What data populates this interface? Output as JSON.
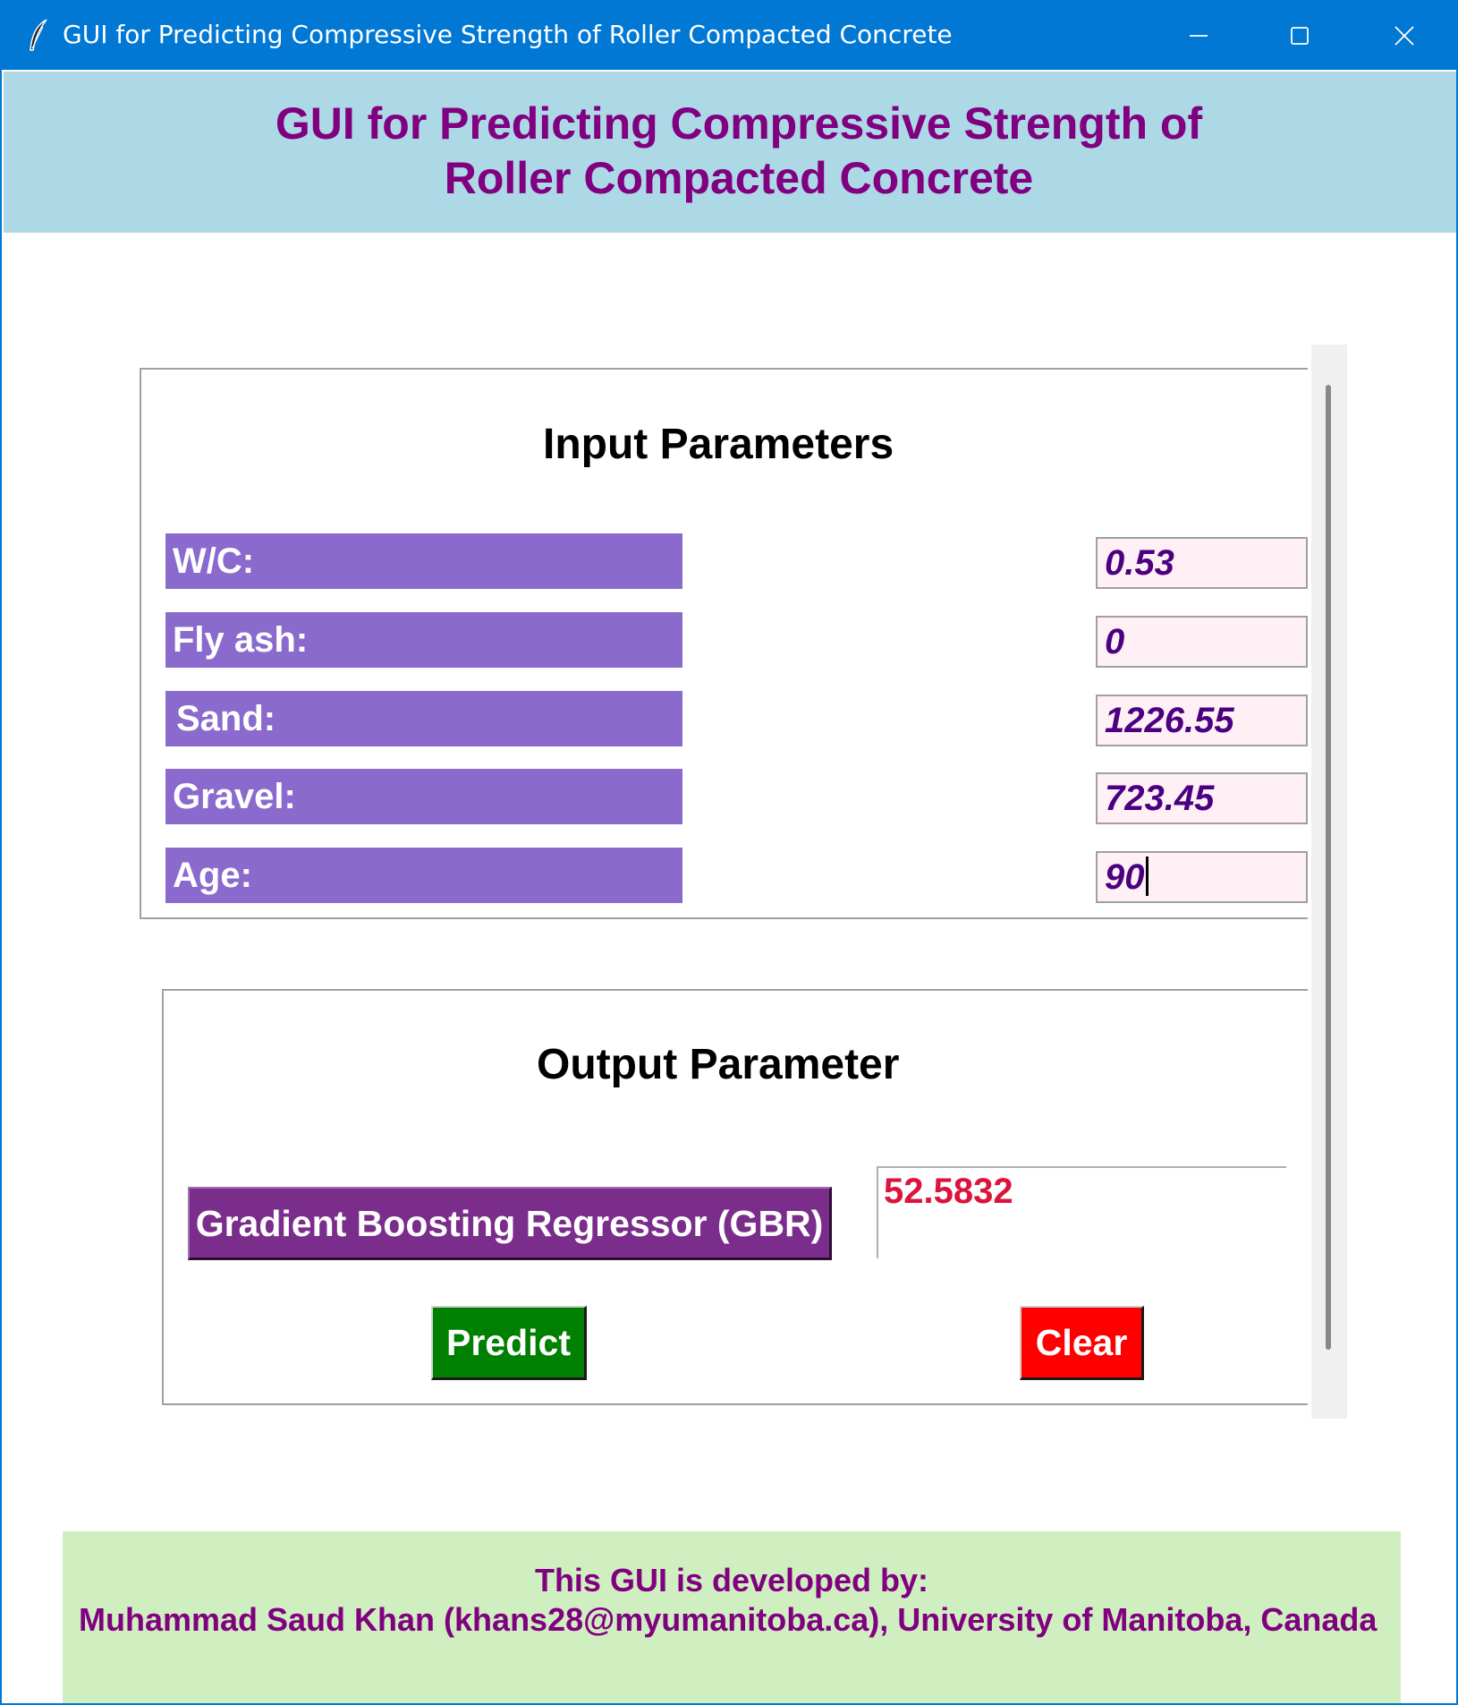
{
  "window": {
    "title": "GUI for Predicting Compressive Strength of Roller Compacted Concrete",
    "icon": "feather-icon",
    "controls": [
      "minimize-icon",
      "maximize-icon",
      "close-icon"
    ],
    "titlebar_color": "#0078d4"
  },
  "header": {
    "line1": "GUI for Predicting Compressive Strength of",
    "line2": "Roller Compacted Concrete",
    "background": "#add8e6",
    "text_color": "#800080"
  },
  "input_section": {
    "title": "Input Parameters",
    "label_color": "#8a6acd",
    "entry_color": "#fff0f5",
    "params": [
      {
        "label": "W/C:",
        "value": "0.53"
      },
      {
        "label": "Fly ash:",
        "value": "0"
      },
      {
        "label": "Sand:",
        "value": "1226.55"
      },
      {
        "label": "Gravel:",
        "value": "723.45"
      },
      {
        "label": "Age:",
        "value": "90"
      }
    ]
  },
  "output_section": {
    "title": "Output Parameter",
    "model_label": "Gradient Boosting Regressor (GBR)",
    "result": "52.5832",
    "predict_label": "Predict",
    "clear_label": "Clear",
    "predict_color": "#008000",
    "clear_color": "#ff0000"
  },
  "footer": {
    "line1": "This GUI is developed by:",
    "line2": "Muhammad Saud Khan (khans28@myumanitoba.ca), University of Manitoba, Canada",
    "background": "#d0efc0"
  }
}
